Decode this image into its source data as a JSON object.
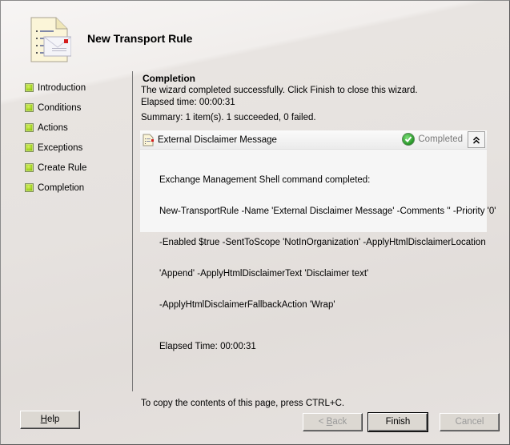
{
  "header": {
    "title": "New Transport Rule",
    "icon": "transport-rule-document-icon"
  },
  "steps": [
    {
      "label": "Introduction",
      "status": "complete"
    },
    {
      "label": "Conditions",
      "status": "complete"
    },
    {
      "label": "Actions",
      "status": "complete"
    },
    {
      "label": "Exceptions",
      "status": "complete"
    },
    {
      "label": "Create Rule",
      "status": "complete"
    },
    {
      "label": "Completion",
      "status": "complete"
    }
  ],
  "content": {
    "section_title": "Completion",
    "message": "The wizard completed successfully. Click Finish to close this wizard.",
    "elapsed": "Elapsed time: 00:00:31",
    "summary": "Summary: 1 item(s). 1 succeeded, 0 failed."
  },
  "result": {
    "name": "External Disclaimer Message",
    "status": "Completed",
    "status_color": "#2b9a2b",
    "command_lines": [
      "Exchange Management Shell command completed:",
      "New-TransportRule -Name 'External Disclaimer Message' -Comments '' -Priority '0'",
      "-Enabled $true -SentToScope 'NotInOrganization' -ApplyHtmlDisclaimerLocation",
      "'Append' -ApplyHtmlDisclaimerText 'Disclaimer text'",
      "-ApplyHtmlDisclaimerFallbackAction 'Wrap'"
    ],
    "elapsed": "Elapsed Time: 00:00:31"
  },
  "footer": {
    "copy_hint": "To copy the contents of this page, press CTRL+C.",
    "help": {
      "label": "Help",
      "accel": "H",
      "rest": "elp"
    },
    "back": {
      "prefix": "< ",
      "accel": "B",
      "rest": "ack",
      "enabled": false
    },
    "finish": {
      "label": "Finish",
      "enabled": true
    },
    "cancel": {
      "label": "Cancel",
      "enabled": false
    }
  }
}
